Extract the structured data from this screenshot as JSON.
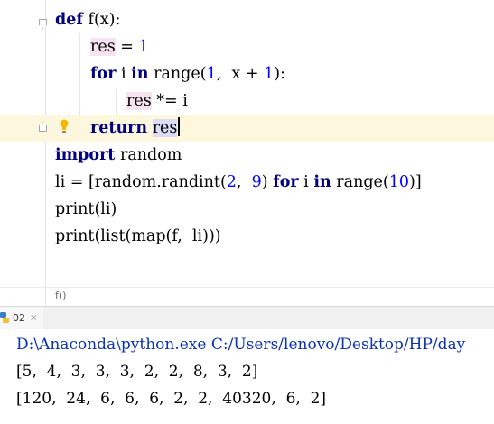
{
  "editor": {
    "lines": [
      {
        "k1": "def",
        "t1": " f",
        "p1": "(",
        "t2": "x",
        "p2": "):"
      },
      {
        "v": "res",
        "t": " = ",
        "n": "1"
      },
      {
        "k1": "for",
        "t1": " i ",
        "k2": "in",
        "t2": " range",
        "p1": "(",
        "n1": "1",
        "t3": ",  x + ",
        "n2": "1",
        "p2": "):"
      },
      {
        "v": "res",
        "t": " *= i"
      },
      {
        "k": "return",
        "t": " ",
        "v": "res"
      },
      {
        "k": "import",
        "t": " random"
      },
      {
        "t1": "li = [random.randint",
        "p1": "(",
        "n1": "2",
        "t2": ",  ",
        "n2": "9",
        "p2": ")",
        "t3": " ",
        "k1": "for",
        "t4": " i ",
        "k2": "in",
        "t5": " range",
        "p3": "(",
        "n3": "10",
        "p4": ")",
        "t6": "]"
      },
      {
        "t": "print(li)"
      },
      {
        "t": "print(list(map(f,  li)))"
      }
    ]
  },
  "breadcrumb": "f()",
  "run_tab": {
    "label": "02",
    "close": "×"
  },
  "console": {
    "command": "D:\\Anaconda\\python.exe C:/Users/lenovo/Desktop/HP/day",
    "output1": "[5,  4,  3,  3,  3,  2,  2,  8,  3,  2]",
    "output2": "[120,  24,  6,  6,  6,  2,  2,  40320,  6,  2]"
  },
  "colors": {
    "keyword": "#000080",
    "number": "#0000ff",
    "current_line": "#fdf7dd",
    "console_command": "#0a33b0"
  },
  "icons": [
    "fold-icon",
    "bulb-icon",
    "python-file-icon"
  ]
}
